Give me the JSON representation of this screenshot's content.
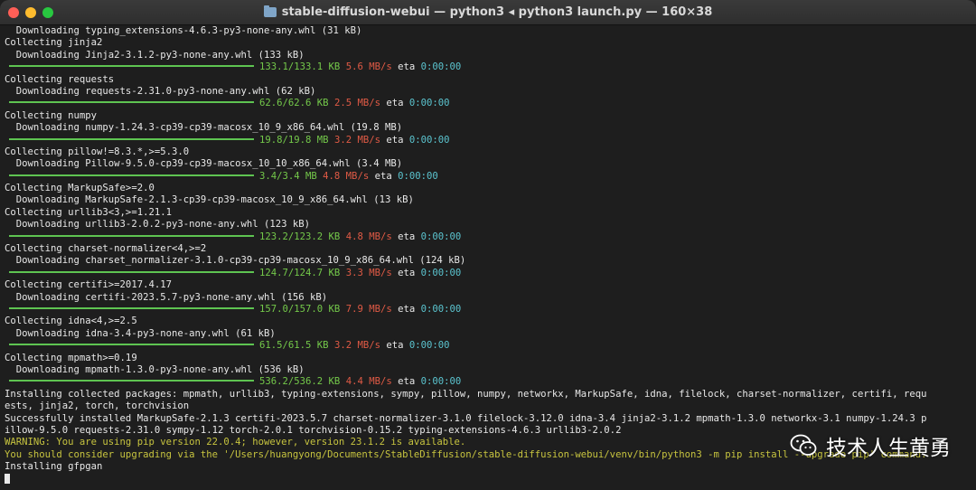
{
  "window": {
    "title": "stable-diffusion-webui — python3 ◂ python3 launch.py — 160×38"
  },
  "lines": [
    {
      "type": "text",
      "text": "  Downloading typing_extensions-4.6.3-py3-none-any.whl (31 kB)"
    },
    {
      "type": "text",
      "text": "Collecting jinja2"
    },
    {
      "type": "text",
      "text": "  Downloading Jinja2-3.1.2-py3-none-any.whl (133 kB)"
    },
    {
      "type": "progress",
      "size": "133.1/133.1 KB",
      "speed": "5.6 MB/s",
      "eta_label": "eta",
      "eta": "0:00:00"
    },
    {
      "type": "text",
      "text": "Collecting requests"
    },
    {
      "type": "text",
      "text": "  Downloading requests-2.31.0-py3-none-any.whl (62 kB)"
    },
    {
      "type": "progress",
      "size": "62.6/62.6 KB",
      "speed": "2.5 MB/s",
      "eta_label": "eta",
      "eta": "0:00:00"
    },
    {
      "type": "text",
      "text": "Collecting numpy"
    },
    {
      "type": "text",
      "text": "  Downloading numpy-1.24.3-cp39-cp39-macosx_10_9_x86_64.whl (19.8 MB)"
    },
    {
      "type": "progress",
      "size": "19.8/19.8 MB",
      "speed": "3.2 MB/s",
      "eta_label": "eta",
      "eta": "0:00:00"
    },
    {
      "type": "text",
      "text": "Collecting pillow!=8.3.*,>=5.3.0"
    },
    {
      "type": "text",
      "text": "  Downloading Pillow-9.5.0-cp39-cp39-macosx_10_10_x86_64.whl (3.4 MB)"
    },
    {
      "type": "progress",
      "size": "3.4/3.4 MB",
      "speed": "4.8 MB/s",
      "eta_label": "eta",
      "eta": "0:00:00"
    },
    {
      "type": "text",
      "text": "Collecting MarkupSafe>=2.0"
    },
    {
      "type": "text",
      "text": "  Downloading MarkupSafe-2.1.3-cp39-cp39-macosx_10_9_x86_64.whl (13 kB)"
    },
    {
      "type": "text",
      "text": "Collecting urllib3<3,>=1.21.1"
    },
    {
      "type": "text",
      "text": "  Downloading urllib3-2.0.2-py3-none-any.whl (123 kB)"
    },
    {
      "type": "progress",
      "size": "123.2/123.2 KB",
      "speed": "4.8 MB/s",
      "eta_label": "eta",
      "eta": "0:00:00"
    },
    {
      "type": "text",
      "text": "Collecting charset-normalizer<4,>=2"
    },
    {
      "type": "text",
      "text": "  Downloading charset_normalizer-3.1.0-cp39-cp39-macosx_10_9_x86_64.whl (124 kB)"
    },
    {
      "type": "progress",
      "size": "124.7/124.7 KB",
      "speed": "3.3 MB/s",
      "eta_label": "eta",
      "eta": "0:00:00"
    },
    {
      "type": "text",
      "text": "Collecting certifi>=2017.4.17"
    },
    {
      "type": "text",
      "text": "  Downloading certifi-2023.5.7-py3-none-any.whl (156 kB)"
    },
    {
      "type": "progress",
      "size": "157.0/157.0 KB",
      "speed": "7.9 MB/s",
      "eta_label": "eta",
      "eta": "0:00:00"
    },
    {
      "type": "text",
      "text": "Collecting idna<4,>=2.5"
    },
    {
      "type": "text",
      "text": "  Downloading idna-3.4-py3-none-any.whl (61 kB)"
    },
    {
      "type": "progress",
      "size": "61.5/61.5 KB",
      "speed": "3.2 MB/s",
      "eta_label": "eta",
      "eta": "0:00:00"
    },
    {
      "type": "text",
      "text": "Collecting mpmath>=0.19"
    },
    {
      "type": "text",
      "text": "  Downloading mpmath-1.3.0-py3-none-any.whl (536 kB)"
    },
    {
      "type": "progress",
      "size": "536.2/536.2 KB",
      "speed": "4.4 MB/s",
      "eta_label": "eta",
      "eta": "0:00:00"
    },
    {
      "type": "text",
      "text": "Installing collected packages: mpmath, urllib3, typing-extensions, sympy, pillow, numpy, networkx, MarkupSafe, idna, filelock, charset-normalizer, certifi, requ"
    },
    {
      "type": "text",
      "text": "ests, jinja2, torch, torchvision"
    },
    {
      "type": "text",
      "text": "Successfully installed MarkupSafe-2.1.3 certifi-2023.5.7 charset-normalizer-3.1.0 filelock-3.12.0 idna-3.4 jinja2-3.1.2 mpmath-1.3.0 networkx-3.1 numpy-1.24.3 p"
    },
    {
      "type": "text",
      "text": "illow-9.5.0 requests-2.31.0 sympy-1.12 torch-2.0.1 torchvision-0.15.2 typing-extensions-4.6.3 urllib3-2.0.2"
    },
    {
      "type": "warning",
      "text": "WARNING: You are using pip version 22.0.4; however, version 23.1.2 is available."
    },
    {
      "type": "warning",
      "text": "You should consider upgrading via the '/Users/huangyong/Documents/StableDiffusion/stable-diffusion-webui/venv/bin/python3 -m pip install --upgrade pip' command."
    },
    {
      "type": "text",
      "text": "Installing gfpgan"
    },
    {
      "type": "cursor"
    }
  ],
  "watermark": {
    "icon": "wechat-icon",
    "text": "技术人生黄勇"
  },
  "colors": {
    "progress_bar": "#5ec451",
    "size": "#74c94a",
    "speed": "#e05a45",
    "eta": "#5bc4cf",
    "warning": "#c7c43f"
  }
}
